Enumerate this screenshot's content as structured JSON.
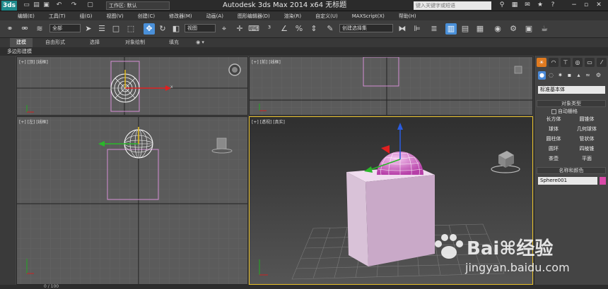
{
  "titlebar": {
    "logo": "3ds",
    "workspace": "工作区: 默认",
    "title": "Autodesk 3ds Max  2014 x64      无标题",
    "help_search_placeholder": "键入关键字或短语"
  },
  "menubar": {
    "items": [
      "编辑(E)",
      "工具(T)",
      "组(G)",
      "视图(V)",
      "创建(C)",
      "修改器(M)",
      "动画(A)",
      "图形编辑器(D)",
      "渲染(R)",
      "自定义(U)",
      "MAXScript(X)",
      "帮助(H)"
    ]
  },
  "toolbar": {
    "filter_select": "全部",
    "coord_select": "视图",
    "named_selection": "创建选择集"
  },
  "ribbon": {
    "tabs": [
      "建模",
      "自由形式",
      "选择",
      "对象绘制",
      "填充"
    ],
    "sub_label": "多边形建模"
  },
  "viewports": {
    "top": "[+] [顶] [线框]",
    "front": "[+] [前] [线框]",
    "left": "[+] [左] [线框]",
    "perspective": "[+] [透视] [真实]"
  },
  "command_panel": {
    "category": "标准基本体",
    "object_type_header": "对象类型",
    "autogrid_label": "自动栅格",
    "buttons": [
      "长方体",
      "圆锥体",
      "球体",
      "几何球体",
      "圆柱体",
      "管状体",
      "圆环",
      "四棱锥",
      "茶壶",
      "平面"
    ],
    "name_color_header": "名称和颜色",
    "object_name": "Sphere001",
    "object_color": "#d94aa8"
  },
  "timeline": {
    "frame_counter": "0 / 100"
  },
  "watermark": {
    "brand": "Bai",
    "brand_cn": "经验",
    "url": "jingyan.baidu.com"
  }
}
